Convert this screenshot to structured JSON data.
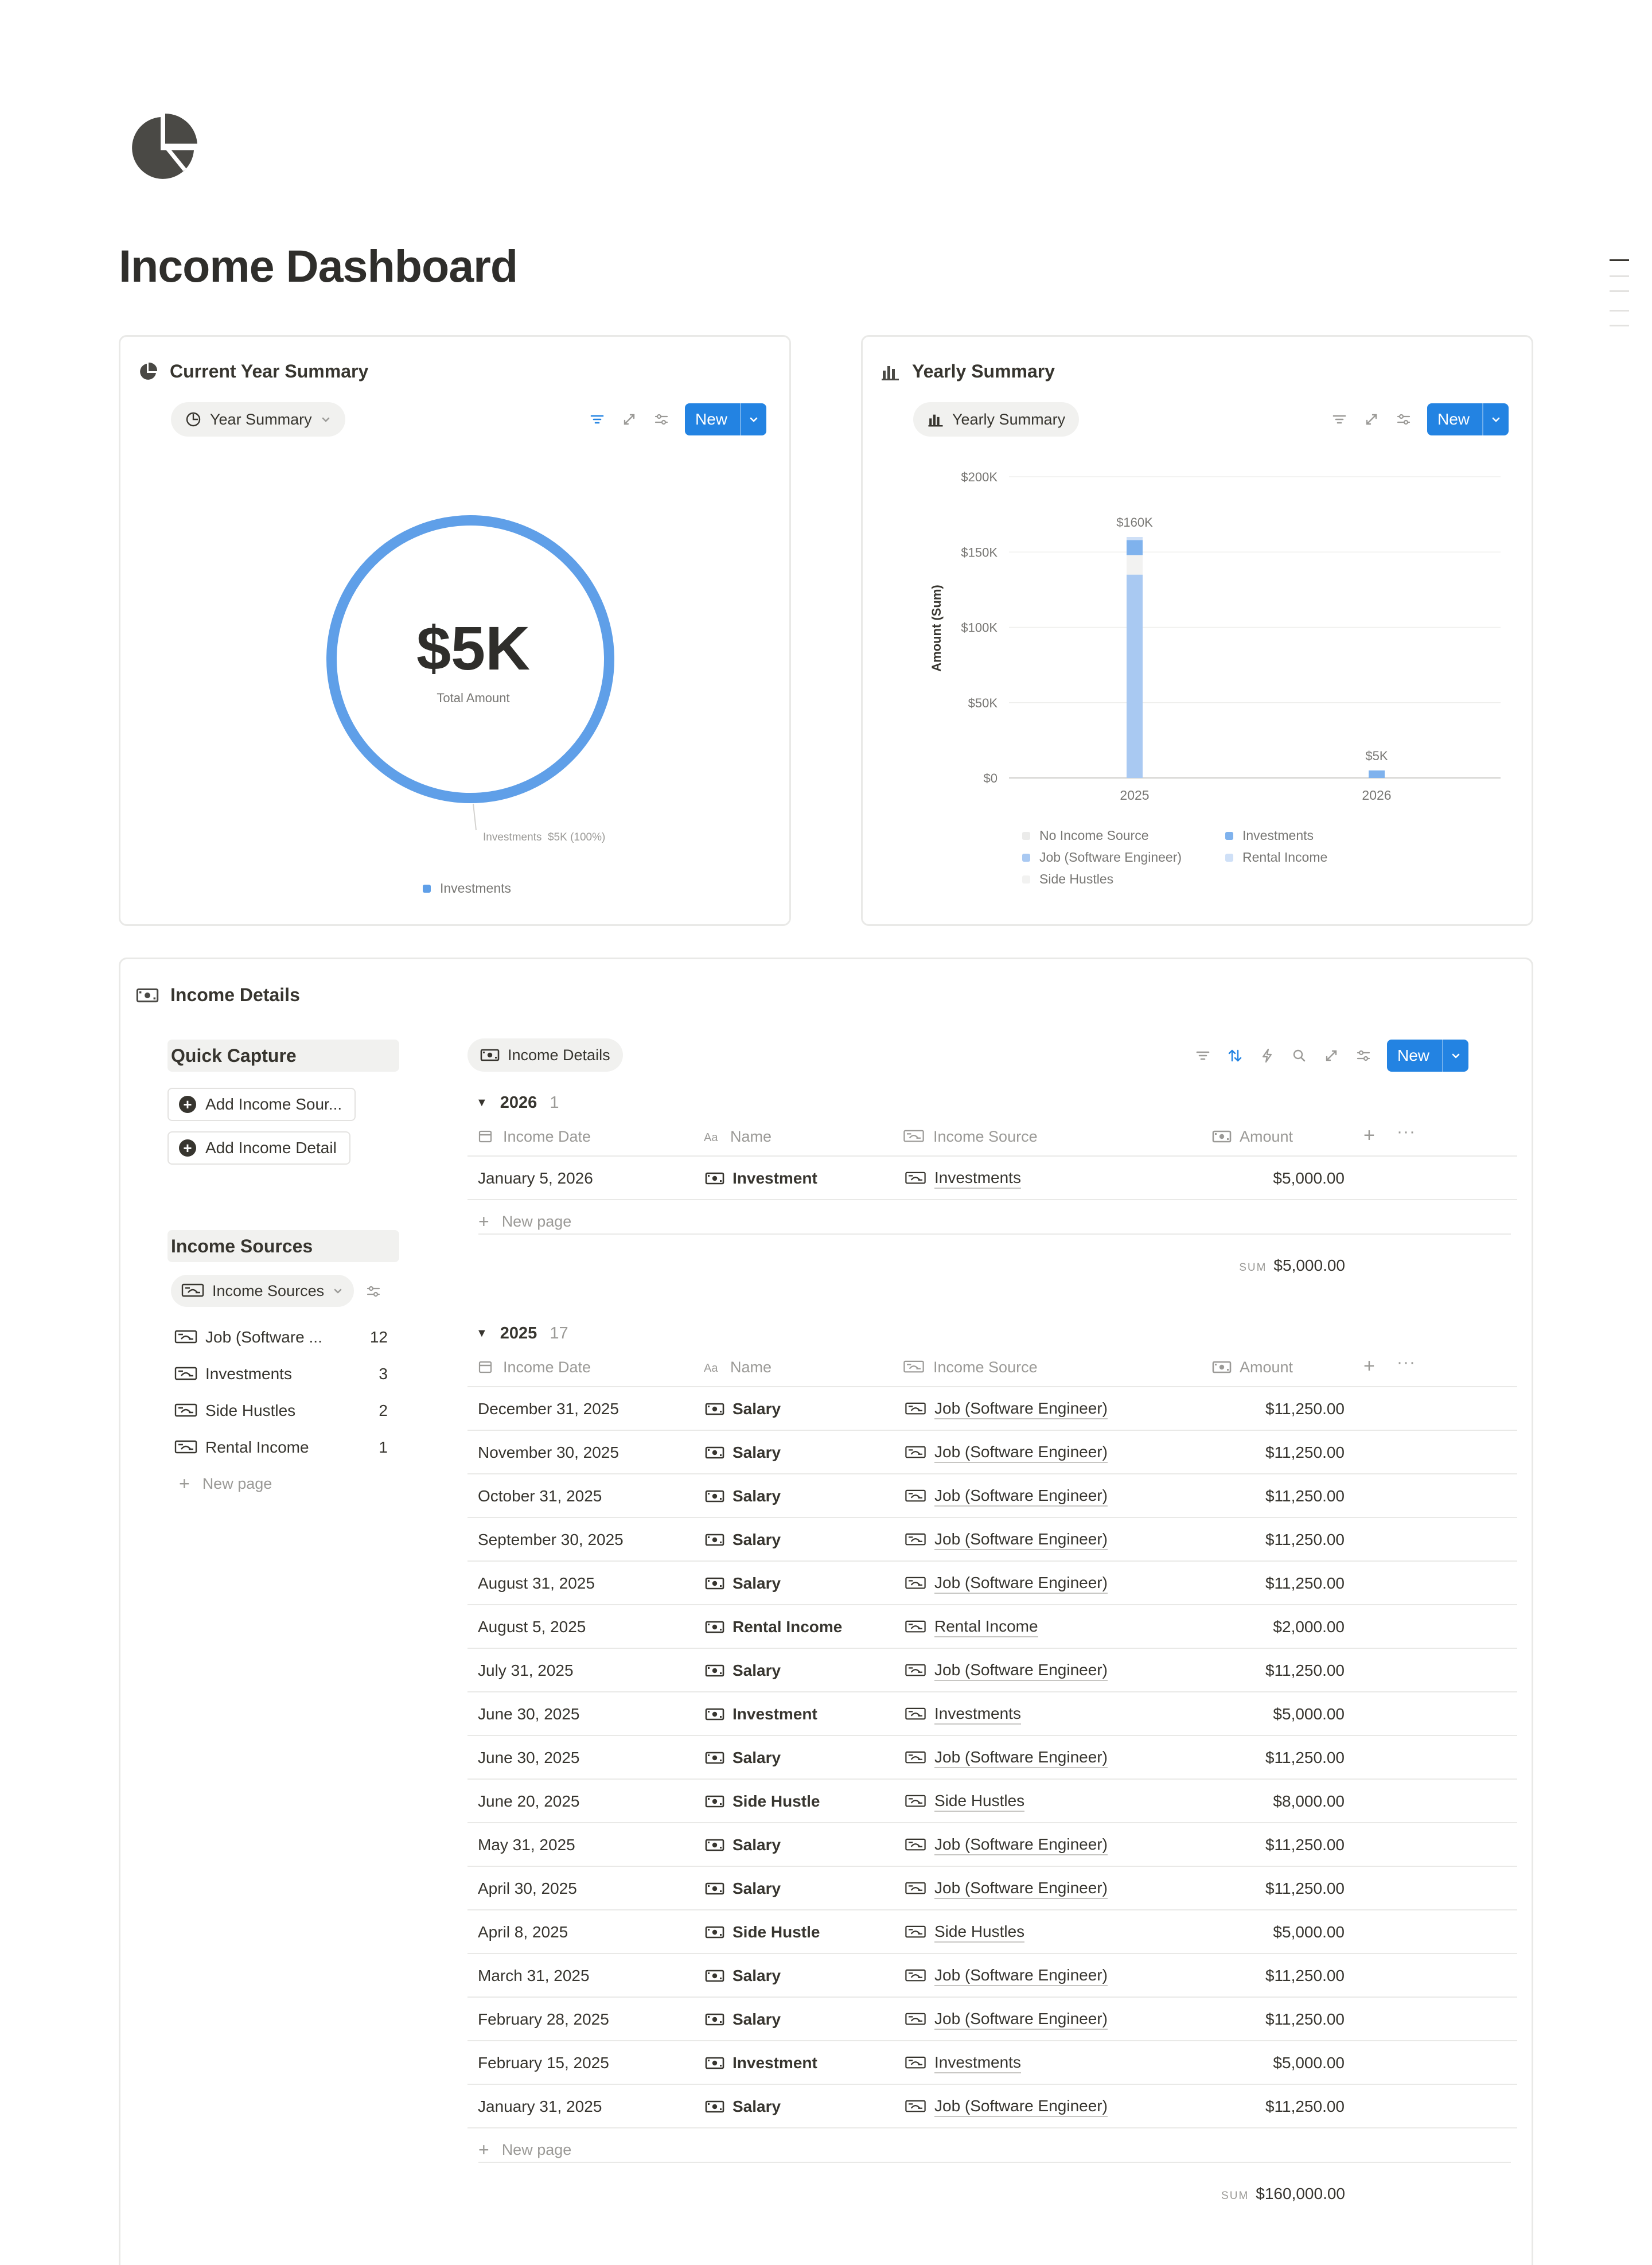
{
  "page": {
    "title": "Income Dashboard",
    "icon": "pie-chart-icon"
  },
  "current_year": {
    "title": "Current Year Summary",
    "tab": "Year Summary",
    "new_label": "New",
    "total_value": "$5K",
    "total_caption": "Total Amount",
    "slice_label": "Investments  $5K (100%)",
    "legend": "Investments"
  },
  "yearly": {
    "title": "Yearly Summary",
    "tab": "Yearly Summary",
    "new_label": "New"
  },
  "chart_data": [
    {
      "type": "pie",
      "title": "",
      "center_value": "$5K",
      "center_caption": "Total Amount",
      "slices": [
        {
          "name": "Investments",
          "value": 5000,
          "percent": 100,
          "label": "$5K (100%)",
          "color": "#5f9fe8"
        }
      ],
      "legend_placement": "bottom"
    },
    {
      "type": "bar",
      "stacked": true,
      "categories": [
        "2025",
        "2026"
      ],
      "series": [
        {
          "name": "No Income Source",
          "color": "#ebebea",
          "values": [
            0,
            0
          ]
        },
        {
          "name": "Job (Software Engineer)",
          "color": "#a9c9f2",
          "values": [
            135000,
            0
          ]
        },
        {
          "name": "Side Hustles",
          "color": "#f2f2f1",
          "values": [
            13000,
            0
          ]
        },
        {
          "name": "Investments",
          "color": "#7fb2ed",
          "values": [
            10000,
            5000
          ]
        },
        {
          "name": "Rental Income",
          "color": "#cfe0f7",
          "values": [
            2000,
            0
          ]
        }
      ],
      "totals": [
        160000,
        5000
      ],
      "total_labels": [
        "$160K",
        "$5K"
      ],
      "ylabel": "Amount (Sum)",
      "xlabel": "",
      "ylim": [
        0,
        200000
      ],
      "yticks": [
        0,
        50000,
        100000,
        150000,
        200000
      ],
      "ytick_labels": [
        "$0",
        "$50K",
        "$100K",
        "$150K",
        "$200K"
      ],
      "grid": true,
      "legend_placement": "bottom"
    }
  ],
  "details": {
    "title": "Income Details",
    "quick_capture": "Quick Capture",
    "add_source": "Add Income Sour...",
    "add_detail": "Add Income Detail",
    "sources_title": "Income Sources",
    "sources_tab": "Income Sources",
    "sources": [
      {
        "name": "Job (Software ...",
        "count": "12"
      },
      {
        "name": "Investments",
        "count": "3"
      },
      {
        "name": "Side Hustles",
        "count": "2"
      },
      {
        "name": "Rental Income",
        "count": "1"
      }
    ],
    "new_page": "New page",
    "table_tab": "Income Details",
    "new_label": "New",
    "columns": {
      "date": "Income Date",
      "name": "Name",
      "source": "Income Source",
      "amount": "Amount"
    },
    "sum_key": "SUM",
    "groups": [
      {
        "label": "2026",
        "count": "1",
        "sum": "$5,000.00",
        "rows": [
          {
            "date": "January 5, 2026",
            "name": "Investment",
            "source": "Investments",
            "amount": "$5,000.00"
          }
        ]
      },
      {
        "label": "2025",
        "count": "17",
        "sum": "$160,000.00",
        "rows": [
          {
            "date": "December 31, 2025",
            "name": "Salary",
            "source": "Job (Software Engineer)",
            "amount": "$11,250.00"
          },
          {
            "date": "November 30, 2025",
            "name": "Salary",
            "source": "Job (Software Engineer)",
            "amount": "$11,250.00"
          },
          {
            "date": "October 31, 2025",
            "name": "Salary",
            "source": "Job (Software Engineer)",
            "amount": "$11,250.00"
          },
          {
            "date": "September 30, 2025",
            "name": "Salary",
            "source": "Job (Software Engineer)",
            "amount": "$11,250.00"
          },
          {
            "date": "August 31, 2025",
            "name": "Salary",
            "source": "Job (Software Engineer)",
            "amount": "$11,250.00"
          },
          {
            "date": "August 5, 2025",
            "name": "Rental Income",
            "source": "Rental Income",
            "amount": "$2,000.00"
          },
          {
            "date": "July 31, 2025",
            "name": "Salary",
            "source": "Job (Software Engineer)",
            "amount": "$11,250.00"
          },
          {
            "date": "June 30, 2025",
            "name": "Investment",
            "source": "Investments",
            "amount": "$5,000.00"
          },
          {
            "date": "June 30, 2025",
            "name": "Salary",
            "source": "Job (Software Engineer)",
            "amount": "$11,250.00"
          },
          {
            "date": "June 20, 2025",
            "name": "Side Hustle",
            "source": "Side Hustles",
            "amount": "$8,000.00"
          },
          {
            "date": "May 31, 2025",
            "name": "Salary",
            "source": "Job (Software Engineer)",
            "amount": "$11,250.00"
          },
          {
            "date": "April 30, 2025",
            "name": "Salary",
            "source": "Job (Software Engineer)",
            "amount": "$11,250.00"
          },
          {
            "date": "April 8, 2025",
            "name": "Side Hustle",
            "source": "Side Hustles",
            "amount": "$5,000.00"
          },
          {
            "date": "March 31, 2025",
            "name": "Salary",
            "source": "Job (Software Engineer)",
            "amount": "$11,250.00"
          },
          {
            "date": "February 28, 2025",
            "name": "Salary",
            "source": "Job (Software Engineer)",
            "amount": "$11,250.00"
          },
          {
            "date": "February 15, 2025",
            "name": "Investment",
            "source": "Investments",
            "amount": "$5,000.00"
          },
          {
            "date": "January 31, 2025",
            "name": "Salary",
            "source": "Job (Software Engineer)",
            "amount": "$11,250.00"
          }
        ]
      }
    ]
  }
}
